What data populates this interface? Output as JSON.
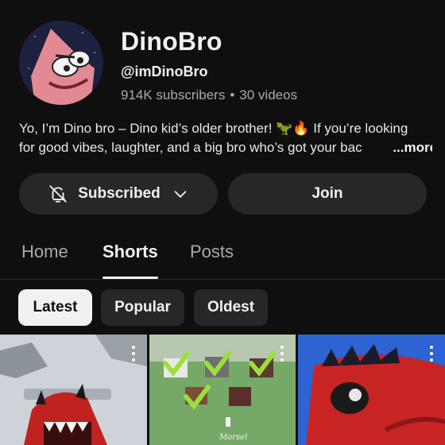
{
  "channel": {
    "name": "DinoBro",
    "handle": "@imDinoBro",
    "subscribers": "914K subscribers",
    "videos": "30 videos",
    "description_line1": "Yo, I’m Dino bro – Dino kid’s older brother! 🦖🔥 If you’re looking",
    "description_line2": "for good vibes, laughter, and a big bro who’s got your bac",
    "more_label": "...more"
  },
  "actions": {
    "subscribed_label": "Subscribed",
    "join_label": "Join"
  },
  "tabs": [
    {
      "label": "Home",
      "active": false
    },
    {
      "label": "Shorts",
      "active": true
    },
    {
      "label": "Posts",
      "active": false
    }
  ],
  "filters": [
    {
      "label": "Latest",
      "selected": true
    },
    {
      "label": "Popular",
      "selected": false
    },
    {
      "label": "Oldest",
      "selected": false
    }
  ],
  "thumbnails": [
    {
      "alt": "red dino monster character"
    },
    {
      "alt": "blocky animals with checkmarks",
      "caption": "Morsel"
    },
    {
      "alt": "red dino closeup"
    }
  ],
  "colors": {
    "background": "#0f0f0f",
    "button_bg": "#272727",
    "text_primary": "#f1f1f1",
    "text_secondary": "#aaaaaa"
  }
}
